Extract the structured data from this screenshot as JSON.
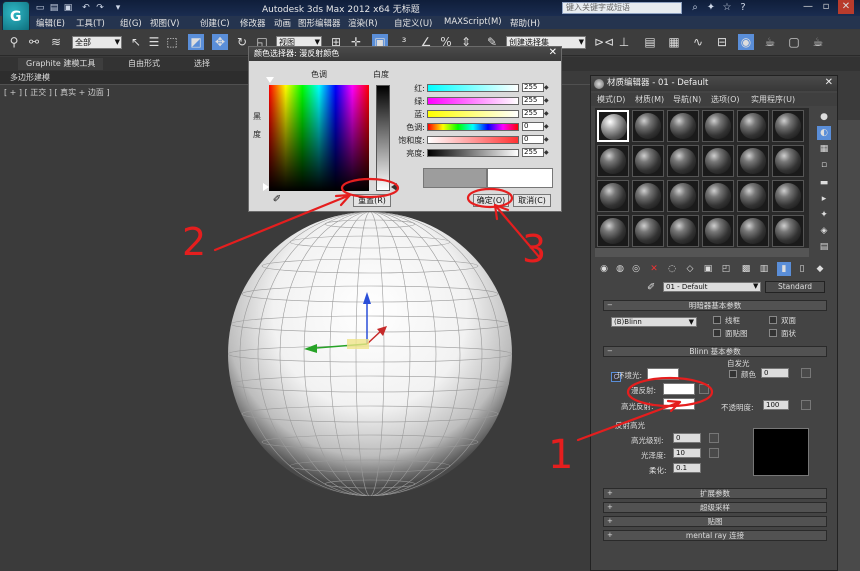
{
  "app": {
    "title": "Autodesk 3ds Max  2012 x64      无标题",
    "logo_letter": "G",
    "search_placeholder": "键入关键字或短语"
  },
  "menu": [
    "编辑(E)",
    "工具(T)",
    "组(G)",
    "视图(V)",
    "创建(C)",
    "修改器",
    "动画",
    "图形编辑器",
    "渲染(R)",
    "自定义(U)",
    "MAXScript(M)",
    "帮助(H)"
  ],
  "toolbar": {
    "filter": "全部",
    "view": "视图",
    "selection_set": "创建选择集"
  },
  "ribbon": {
    "tabs": [
      "Graphite 建模工具",
      "自由形式",
      "选择"
    ],
    "subtitle": "多边形建模"
  },
  "viewport": {
    "label": "[ + ] [ 正交 ] [ 真实 + 边面 ]"
  },
  "color_dialog": {
    "title": "颜色选择器: 漫反射颜色",
    "hue_label": "色调",
    "white_label": "白度",
    "black_label": "黑",
    "degree_label": "度",
    "channels": [
      {
        "label": "红:",
        "value": "255"
      },
      {
        "label": "绿:",
        "value": "255"
      },
      {
        "label": "蓝:",
        "value": "255"
      },
      {
        "label": "色调:",
        "value": "0"
      },
      {
        "label": "饱和度:",
        "value": "0"
      },
      {
        "label": "亮度:",
        "value": "255"
      }
    ],
    "reset_label": "重置(R)",
    "ok_label": "确定(O)",
    "cancel_label": "取消(C)"
  },
  "material_editor": {
    "title": "材质编辑器 - 01 - Default",
    "menu": [
      "模式(D)",
      "材质(M)",
      "导航(N)",
      "选项(O)",
      "实用程序(U)"
    ],
    "material_name": "01 - Default",
    "material_type": "Standard",
    "shader_rollout": "明暗器基本参数",
    "shader": "(B)Blinn",
    "shader_opts": [
      "线框",
      "双面",
      "面贴图",
      "面状"
    ],
    "blinn_rollout": "Blinn 基本参数",
    "self_illum": "自发光",
    "color_label": "颜色",
    "color_value": "0",
    "ambient": "环境光:",
    "diffuse": "漫反射:",
    "specular": "高光反射:",
    "opacity_label": "不透明度:",
    "opacity_value": "100",
    "spec_highlights": "反射高光",
    "spec_level": "高光级别:",
    "spec_level_value": "0",
    "glossiness": "光泽度:",
    "glossiness_value": "10",
    "soften": "柔化:",
    "soften_value": "0.1",
    "rollouts": [
      "扩展参数",
      "超级采样",
      "贴图",
      "mental ray 连接"
    ]
  },
  "annotations": [
    "1",
    "2",
    "3"
  ]
}
